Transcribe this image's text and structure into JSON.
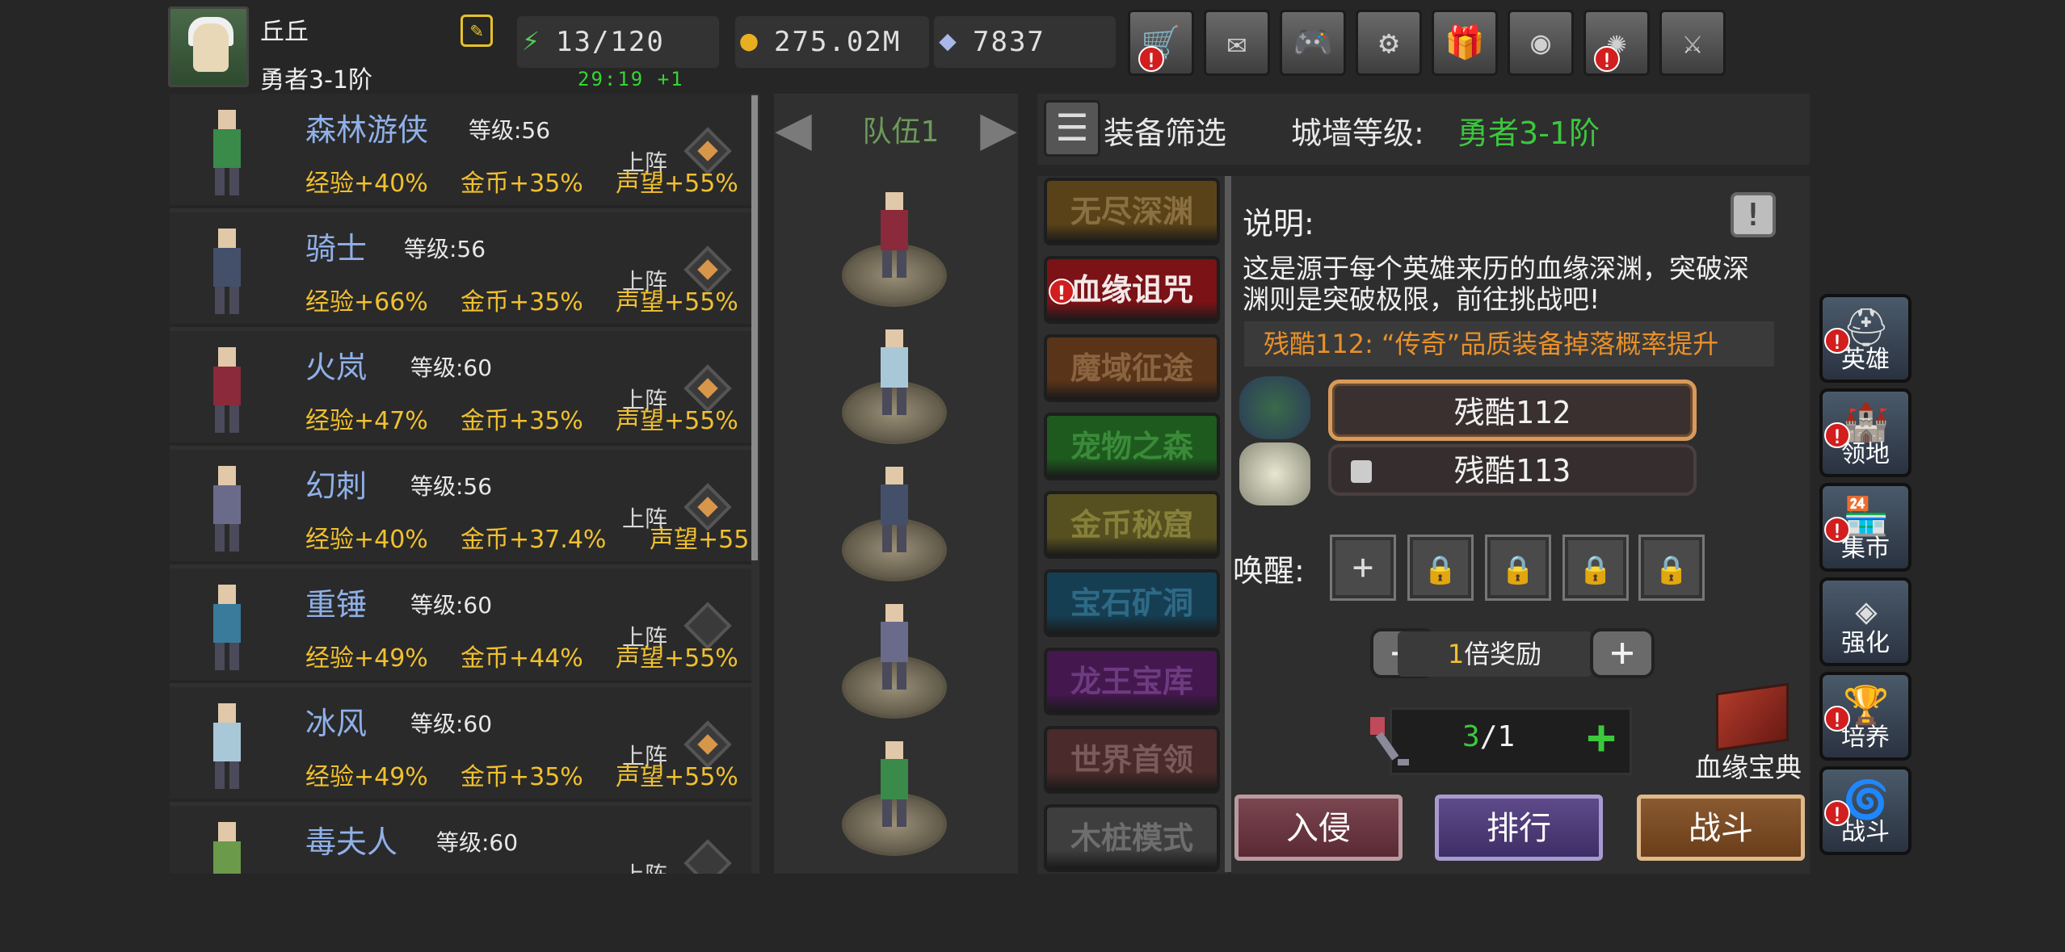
{
  "player": {
    "name": "丘丘",
    "rank": "勇者3-1阶"
  },
  "resources": {
    "energy": "13/120",
    "energy_timer": "29:19 +1",
    "gold": "275.02M",
    "gems": "7837"
  },
  "top_buttons": [
    {
      "icon": "cart-icon",
      "glyph": "🛒",
      "alert": true
    },
    {
      "icon": "mail-icon",
      "glyph": "✉",
      "alert": false
    },
    {
      "icon": "gamepad-icon",
      "glyph": "🎮",
      "alert": false
    },
    {
      "icon": "gear-icon",
      "glyph": "⚙",
      "alert": false
    },
    {
      "icon": "gift-icon",
      "glyph": "🎁",
      "alert": false
    },
    {
      "icon": "color-wheel-icon",
      "glyph": "◉",
      "alert": false
    },
    {
      "icon": "firework-icon",
      "glyph": "✺",
      "alert": true
    },
    {
      "icon": "crossed-swords-icon",
      "glyph": "⚔",
      "alert": false
    }
  ],
  "heroes": [
    {
      "name": "森林游侠",
      "level": "等级:56",
      "deploy": "上阵",
      "exp": "经验+40%",
      "gold": "金币+35%",
      "fame": "声望+55%",
      "equipped": true,
      "color": "#3a8a4a"
    },
    {
      "name": "骑士",
      "level": "等级:56",
      "deploy": "上阵",
      "exp": "经验+66%",
      "gold": "金币+35%",
      "fame": "声望+55%",
      "equipped": true,
      "color": "#44506a"
    },
    {
      "name": "火岚",
      "level": "等级:60",
      "deploy": "上阵",
      "exp": "经验+47%",
      "gold": "金币+35%",
      "fame": "声望+55%",
      "equipped": true,
      "color": "#8a2a3a"
    },
    {
      "name": "幻刺",
      "level": "等级:56",
      "deploy": "上阵",
      "exp": "经验+40%",
      "gold": "金币+37.4%",
      "fame": "声望+55",
      "equipped": true,
      "color": "#6a6a8a"
    },
    {
      "name": "重锤",
      "level": "等级:60",
      "deploy": "上阵",
      "exp": "经验+49%",
      "gold": "金币+44%",
      "fame": "声望+55%",
      "equipped": false,
      "color": "#3a7a9a"
    },
    {
      "name": "冰风",
      "level": "等级:60",
      "deploy": "上阵",
      "exp": "经验+49%",
      "gold": "金币+35%",
      "fame": "声望+55%",
      "equipped": true,
      "color": "#a8c8d8"
    },
    {
      "name": "毒夫人",
      "level": "等级:60",
      "deploy": "上阵",
      "exp": "",
      "gold": "",
      "fame": "",
      "equipped": false,
      "color": "#6a9a4a"
    }
  ],
  "team": {
    "label": "队伍1",
    "members": [
      "#8a2a3a",
      "#a8c8d8",
      "#44506a",
      "#6a6a8a",
      "#3a8a4a"
    ]
  },
  "header": {
    "filter_label": "装备筛选",
    "wall_label": "城墙等级:",
    "wall_value": "勇者3-1阶"
  },
  "modes": [
    {
      "label": "无尽深渊",
      "bg": "#5a4218",
      "fg": "#8a7040",
      "alert": false
    },
    {
      "label": "血缘诅咒",
      "bg": "#7a1216",
      "fg": "#f4e8e8",
      "alert": true
    },
    {
      "label": "魔域征途",
      "bg": "#5a3418",
      "fg": "#8a6440",
      "alert": false
    },
    {
      "label": "宠物之森",
      "bg": "#1e5a1e",
      "fg": "#3a8a3a",
      "alert": false
    },
    {
      "label": "金币秘窟",
      "bg": "#565020",
      "fg": "#86803a",
      "alert": false
    },
    {
      "label": "宝石矿洞",
      "bg": "#163e52",
      "fg": "#2e6a86",
      "alert": false
    },
    {
      "label": "龙王宝库",
      "bg": "#44184e",
      "fg": "#6e3a80",
      "alert": false
    },
    {
      "label": "世界首领",
      "bg": "#4a2a2a",
      "fg": "#7a5a5a",
      "alert": false
    },
    {
      "label": "木桩模式",
      "bg": "#3e3e3e",
      "fg": "#6e6e6e",
      "alert": false
    }
  ],
  "detail": {
    "title": "说明:",
    "description": "这是源于每个英雄来历的血缘深渊，突破深渊则是突破极限，前往挑战吧!",
    "drop_note": "残酷112: “传奇”品质装备掉落概率提升",
    "difficulty_current": "残酷112",
    "difficulty_next": "残酷113",
    "awaken_label": "唤醒:",
    "reward_multiplier": "1",
    "reward_text": "倍奖励",
    "tickets": "3/1",
    "codex_label": "血缘宝典",
    "actions": {
      "invade": "入侵",
      "rank": "排行",
      "battle": "战斗"
    }
  },
  "side_nav": [
    {
      "label": "英雄",
      "icon": "helmet-icon",
      "glyph": "⛑",
      "alert": true
    },
    {
      "label": "领地",
      "icon": "castle-icon",
      "glyph": "🏰",
      "alert": true
    },
    {
      "label": "集市",
      "icon": "market-icon",
      "glyph": "🏪",
      "alert": true
    },
    {
      "label": "强化",
      "icon": "crystal-icon",
      "glyph": "◈",
      "alert": false
    },
    {
      "label": "培养",
      "icon": "chalice-icon",
      "glyph": "🏆",
      "alert": true
    },
    {
      "label": "战斗",
      "icon": "portal-icon",
      "glyph": "🌀",
      "alert": true
    }
  ],
  "colors": {
    "accent_green": "#3cc83c",
    "gold_text": "#f0c030",
    "hero_name": "#8fb0e8",
    "alert_red": "#d21e1e"
  }
}
